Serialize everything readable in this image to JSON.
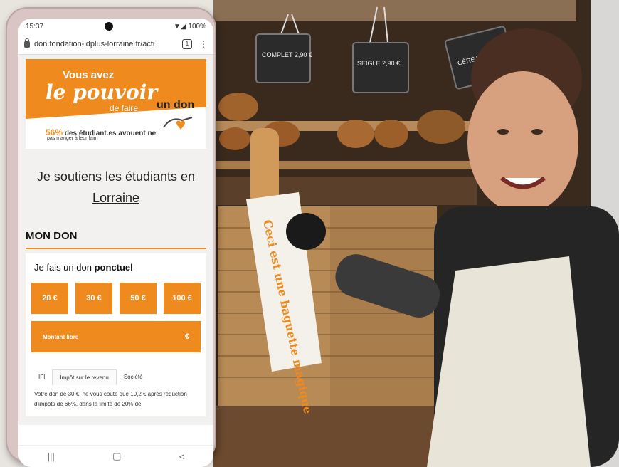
{
  "status": {
    "time": "15:37",
    "battery": "100%"
  },
  "browser": {
    "url": "don.fondation-idplus-lorraine.fr/acti",
    "tab_count": "1",
    "menu_icon": "more-vert-icon"
  },
  "banner": {
    "line1": "Vous avez",
    "line2": "le pouvoir",
    "line3": "de faire",
    "line4": "un don",
    "stat_pct": "56%",
    "stat_text": "des étudiant.es avouent ne",
    "stat_text2": "pas manger à leur faim"
  },
  "page": {
    "title": "Je soutiens les étudiants en Lorraine",
    "section": "MON DON",
    "card_title_prefix": "Je fais un don",
    "card_title_bold": "ponctuel",
    "amounts": [
      "20 €",
      "30 €",
      "50 €",
      "100 €"
    ],
    "free_label": "Montant libre",
    "free_currency": "€",
    "tabs": [
      "IFI",
      "Impôt sur le revenu",
      "Société"
    ],
    "description": "Votre don de 30 €, ne vous coûte que 10,2 € après réduction d'impôts de 66%, dans la limite de 20% de"
  },
  "photo": {
    "chalk_signs": [
      "COMPLET 2,90 €",
      "SEIGLE 2,90 €",
      "CÉRÉALES"
    ],
    "bag_text": "Ceci est une baguette magique"
  },
  "navbar": {
    "items": [
      "|||",
      "▢",
      "<"
    ]
  },
  "colors": {
    "accent": "#ef8b1e"
  }
}
